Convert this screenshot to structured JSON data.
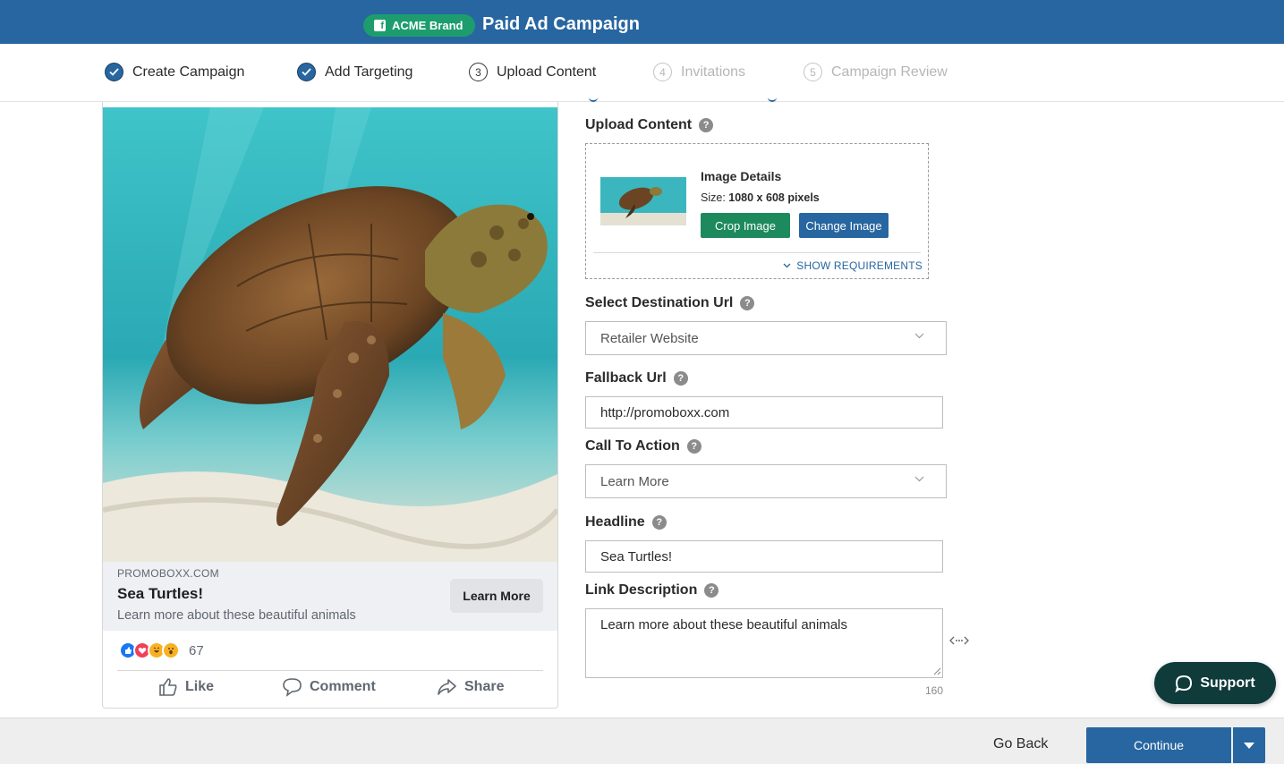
{
  "header": {
    "brand_label": "ACME Brand",
    "brand_icon": "facebook-icon",
    "title": "Paid Ad Campaign",
    "colors": {
      "bar": "#2766a0",
      "brand_pill": "#1d9d6e"
    }
  },
  "stepper": {
    "steps": [
      {
        "number": "1",
        "label": "Create Campaign",
        "state": "done"
      },
      {
        "number": "2",
        "label": "Add Targeting",
        "state": "done"
      },
      {
        "number": "3",
        "label": "Upload Content",
        "state": "active"
      },
      {
        "number": "4",
        "label": "Invitations",
        "state": "future"
      },
      {
        "number": "5",
        "label": "Campaign Review",
        "state": "future"
      }
    ]
  },
  "preview": {
    "domain": "PROMOBOXX.COM",
    "headline": "Sea Turtles!",
    "description": "Learn more about these beautiful animals",
    "cta": "Learn More",
    "reaction_count": "67",
    "reaction_icons": [
      "like-icon",
      "love-icon",
      "haha-icon",
      "wow-icon"
    ],
    "actions": [
      {
        "label": "Like",
        "icon": "thumbs-up-icon"
      },
      {
        "label": "Comment",
        "icon": "comment-icon"
      },
      {
        "label": "Share",
        "icon": "share-icon"
      }
    ]
  },
  "form": {
    "upload": {
      "label": "Upload Content",
      "details_title": "Image Details",
      "size_label": "Size:",
      "size_value": "1080 x 608 pixels",
      "crop_button": "Crop Image",
      "change_button": "Change Image",
      "show_requirements": "SHOW REQUIREMENTS"
    },
    "destination": {
      "label": "Select Destination Url",
      "value": "Retailer Website"
    },
    "fallback": {
      "label": "Fallback Url",
      "value": "http://promoboxx.com"
    },
    "cta": {
      "label": "Call To Action",
      "value": "Learn More"
    },
    "headline": {
      "label": "Headline",
      "value": "Sea Turtles!"
    },
    "link_description": {
      "label": "Link Description",
      "value": "Learn more about these beautiful animals",
      "counter": "160"
    },
    "help_glyph": "?"
  },
  "footer": {
    "go_back": "Go Back",
    "continue": "Continue"
  },
  "support": {
    "label": "Support"
  }
}
